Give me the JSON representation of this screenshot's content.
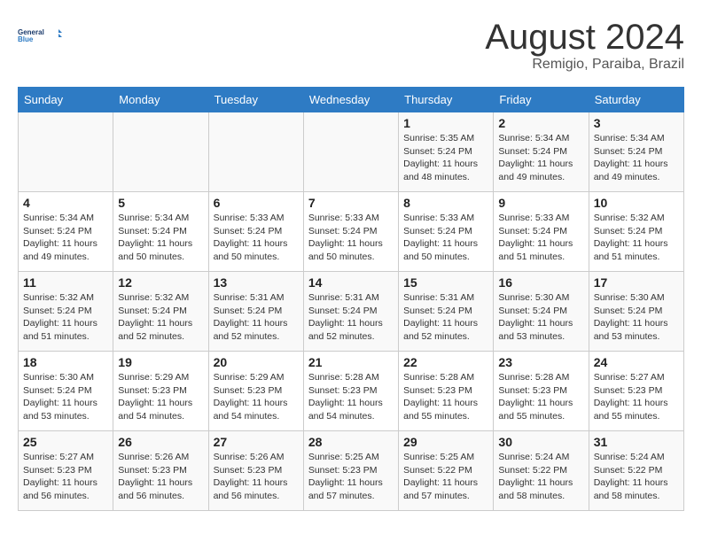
{
  "header": {
    "logo_line1": "General",
    "logo_line2": "Blue",
    "month": "August 2024",
    "location": "Remigio, Paraiba, Brazil"
  },
  "days_of_week": [
    "Sunday",
    "Monday",
    "Tuesday",
    "Wednesday",
    "Thursday",
    "Friday",
    "Saturday"
  ],
  "weeks": [
    [
      {
        "day": "",
        "detail": ""
      },
      {
        "day": "",
        "detail": ""
      },
      {
        "day": "",
        "detail": ""
      },
      {
        "day": "",
        "detail": ""
      },
      {
        "day": "1",
        "detail": "Sunrise: 5:35 AM\nSunset: 5:24 PM\nDaylight: 11 hours\nand 48 minutes."
      },
      {
        "day": "2",
        "detail": "Sunrise: 5:34 AM\nSunset: 5:24 PM\nDaylight: 11 hours\nand 49 minutes."
      },
      {
        "day": "3",
        "detail": "Sunrise: 5:34 AM\nSunset: 5:24 PM\nDaylight: 11 hours\nand 49 minutes."
      }
    ],
    [
      {
        "day": "4",
        "detail": "Sunrise: 5:34 AM\nSunset: 5:24 PM\nDaylight: 11 hours\nand 49 minutes."
      },
      {
        "day": "5",
        "detail": "Sunrise: 5:34 AM\nSunset: 5:24 PM\nDaylight: 11 hours\nand 50 minutes."
      },
      {
        "day": "6",
        "detail": "Sunrise: 5:33 AM\nSunset: 5:24 PM\nDaylight: 11 hours\nand 50 minutes."
      },
      {
        "day": "7",
        "detail": "Sunrise: 5:33 AM\nSunset: 5:24 PM\nDaylight: 11 hours\nand 50 minutes."
      },
      {
        "day": "8",
        "detail": "Sunrise: 5:33 AM\nSunset: 5:24 PM\nDaylight: 11 hours\nand 50 minutes."
      },
      {
        "day": "9",
        "detail": "Sunrise: 5:33 AM\nSunset: 5:24 PM\nDaylight: 11 hours\nand 51 minutes."
      },
      {
        "day": "10",
        "detail": "Sunrise: 5:32 AM\nSunset: 5:24 PM\nDaylight: 11 hours\nand 51 minutes."
      }
    ],
    [
      {
        "day": "11",
        "detail": "Sunrise: 5:32 AM\nSunset: 5:24 PM\nDaylight: 11 hours\nand 51 minutes."
      },
      {
        "day": "12",
        "detail": "Sunrise: 5:32 AM\nSunset: 5:24 PM\nDaylight: 11 hours\nand 52 minutes."
      },
      {
        "day": "13",
        "detail": "Sunrise: 5:31 AM\nSunset: 5:24 PM\nDaylight: 11 hours\nand 52 minutes."
      },
      {
        "day": "14",
        "detail": "Sunrise: 5:31 AM\nSunset: 5:24 PM\nDaylight: 11 hours\nand 52 minutes."
      },
      {
        "day": "15",
        "detail": "Sunrise: 5:31 AM\nSunset: 5:24 PM\nDaylight: 11 hours\nand 52 minutes."
      },
      {
        "day": "16",
        "detail": "Sunrise: 5:30 AM\nSunset: 5:24 PM\nDaylight: 11 hours\nand 53 minutes."
      },
      {
        "day": "17",
        "detail": "Sunrise: 5:30 AM\nSunset: 5:24 PM\nDaylight: 11 hours\nand 53 minutes."
      }
    ],
    [
      {
        "day": "18",
        "detail": "Sunrise: 5:30 AM\nSunset: 5:24 PM\nDaylight: 11 hours\nand 53 minutes."
      },
      {
        "day": "19",
        "detail": "Sunrise: 5:29 AM\nSunset: 5:23 PM\nDaylight: 11 hours\nand 54 minutes."
      },
      {
        "day": "20",
        "detail": "Sunrise: 5:29 AM\nSunset: 5:23 PM\nDaylight: 11 hours\nand 54 minutes."
      },
      {
        "day": "21",
        "detail": "Sunrise: 5:28 AM\nSunset: 5:23 PM\nDaylight: 11 hours\nand 54 minutes."
      },
      {
        "day": "22",
        "detail": "Sunrise: 5:28 AM\nSunset: 5:23 PM\nDaylight: 11 hours\nand 55 minutes."
      },
      {
        "day": "23",
        "detail": "Sunrise: 5:28 AM\nSunset: 5:23 PM\nDaylight: 11 hours\nand 55 minutes."
      },
      {
        "day": "24",
        "detail": "Sunrise: 5:27 AM\nSunset: 5:23 PM\nDaylight: 11 hours\nand 55 minutes."
      }
    ],
    [
      {
        "day": "25",
        "detail": "Sunrise: 5:27 AM\nSunset: 5:23 PM\nDaylight: 11 hours\nand 56 minutes."
      },
      {
        "day": "26",
        "detail": "Sunrise: 5:26 AM\nSunset: 5:23 PM\nDaylight: 11 hours\nand 56 minutes."
      },
      {
        "day": "27",
        "detail": "Sunrise: 5:26 AM\nSunset: 5:23 PM\nDaylight: 11 hours\nand 56 minutes."
      },
      {
        "day": "28",
        "detail": "Sunrise: 5:25 AM\nSunset: 5:23 PM\nDaylight: 11 hours\nand 57 minutes."
      },
      {
        "day": "29",
        "detail": "Sunrise: 5:25 AM\nSunset: 5:22 PM\nDaylight: 11 hours\nand 57 minutes."
      },
      {
        "day": "30",
        "detail": "Sunrise: 5:24 AM\nSunset: 5:22 PM\nDaylight: 11 hours\nand 58 minutes."
      },
      {
        "day": "31",
        "detail": "Sunrise: 5:24 AM\nSunset: 5:22 PM\nDaylight: 11 hours\nand 58 minutes."
      }
    ]
  ]
}
